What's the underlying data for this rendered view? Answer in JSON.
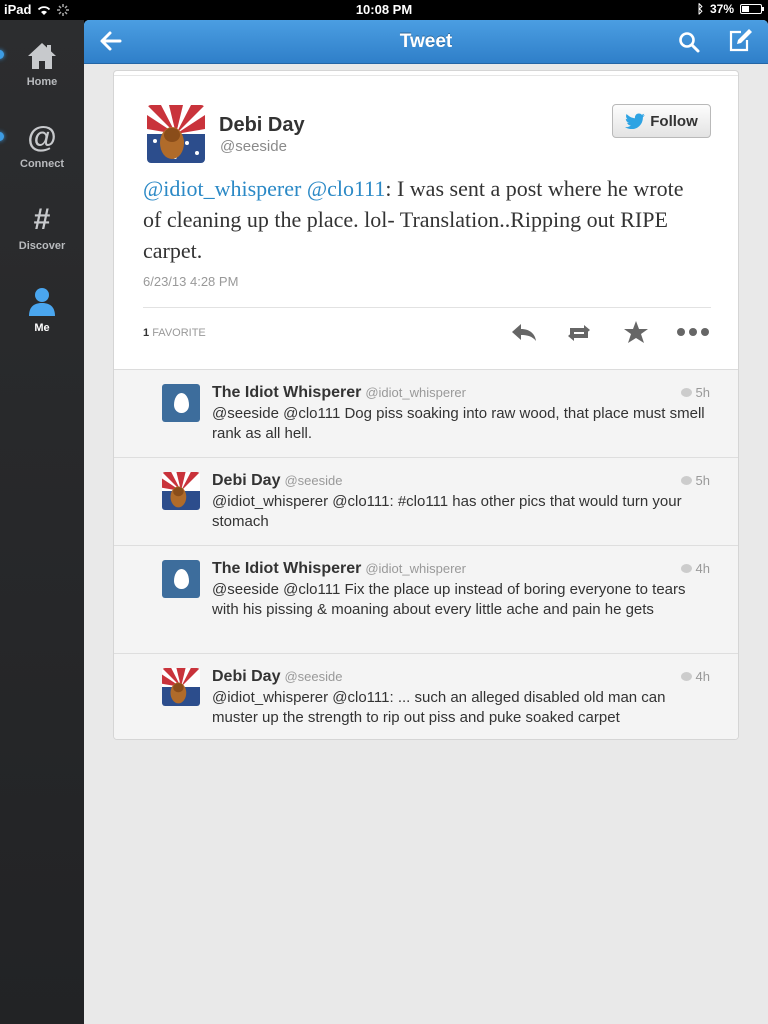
{
  "statusbar": {
    "device": "iPad",
    "time": "10:08 PM",
    "battery": "37%",
    "battery_level": 0.37
  },
  "sidebar": {
    "items": [
      {
        "label": "Home",
        "icon": "home-icon"
      },
      {
        "label": "Connect",
        "icon": "at-icon"
      },
      {
        "label": "Discover",
        "icon": "hash-icon"
      },
      {
        "label": "Me",
        "icon": "person-icon"
      }
    ]
  },
  "header": {
    "title": "Tweet"
  },
  "tweet": {
    "author_name": "Debi Day",
    "author_handle": "@seeside",
    "follow_label": "Follow",
    "mention1": "@idiot_whisperer",
    "mention2": "@clo111",
    "body": ": I was sent a post where he wrote of cleaning up the place. lol- Translation..Ripping out RIPE carpet.",
    "timestamp": "6/23/13 4:28 PM",
    "favorites_count": "1",
    "favorites_label": "FAVORITE"
  },
  "colors": {
    "accent": "#2b89c6",
    "navbar": "#3a8bd6",
    "sidebar": "#262729"
  },
  "replies": [
    {
      "name": "The Idiot Whisperer",
      "handle": "@idiot_whisperer",
      "time": "5h",
      "text": "@seeside @clo111 Dog piss soaking into raw wood, that place must smell  rank as all hell.",
      "avatar": "egg-avatar"
    },
    {
      "name": "Debi Day",
      "handle": "@seeside",
      "time": "5h",
      "text": "@idiot_whisperer @clo111: #clo111 has other pics that would turn your stomach",
      "avatar": "flag-avatar"
    },
    {
      "name": "The Idiot Whisperer",
      "handle": "@idiot_whisperer",
      "time": "4h",
      "text": "@seeside @clo111 Fix the place up instead of boring everyone to tears with his pissing & moaning about every little ache and pain he gets",
      "avatar": "egg-avatar"
    },
    {
      "name": "Debi Day",
      "handle": "@seeside",
      "time": "4h",
      "text": "@idiot_whisperer @clo111: ... such an alleged disabled old man can muster up the strength to rip out piss and puke soaked carpet",
      "avatar": "flag-avatar"
    }
  ]
}
